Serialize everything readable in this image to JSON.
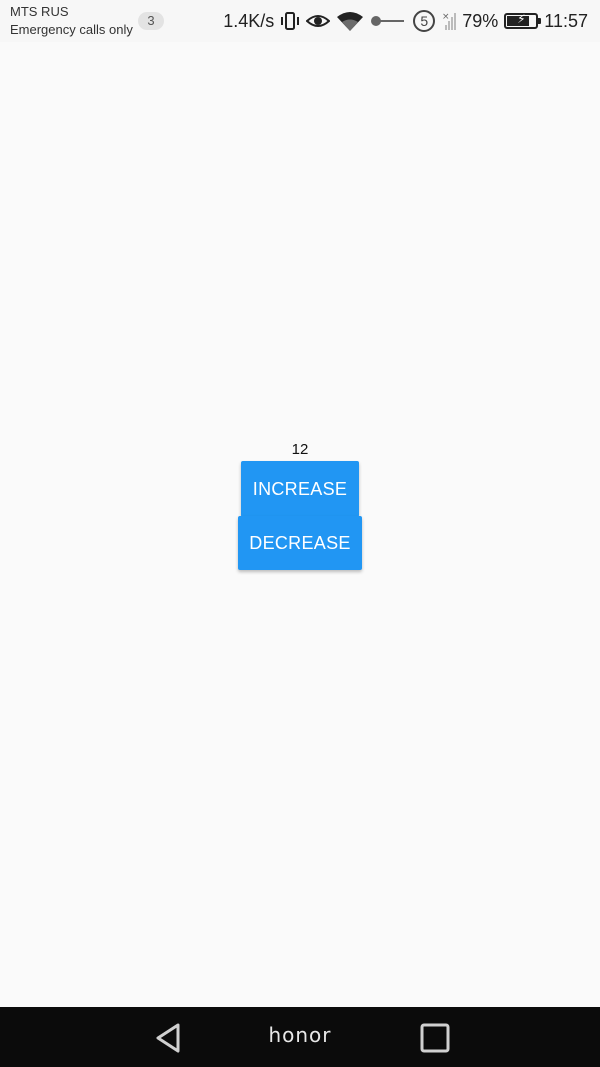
{
  "status_bar": {
    "carrier": "MTS RUS",
    "carrier_status": "Emergency calls only",
    "notification_count": "3",
    "net_speed": "1.4K/s",
    "sim_slot": "5",
    "battery_percent": "79%",
    "battery_level": 0.79,
    "time": "11:57",
    "icons": [
      "vibrate-icon",
      "eye-icon",
      "wifi-icon",
      "data-toggle-icon",
      "sim-icon",
      "signal-icon",
      "battery-icon"
    ]
  },
  "main": {
    "counter_value": "12",
    "increase_label": "INCREASE",
    "decrease_label": "DECREASE",
    "button_color": "#2196f3"
  },
  "nav_bar": {
    "brand": "honor",
    "icons": [
      "back-icon",
      "recents-icon"
    ]
  }
}
